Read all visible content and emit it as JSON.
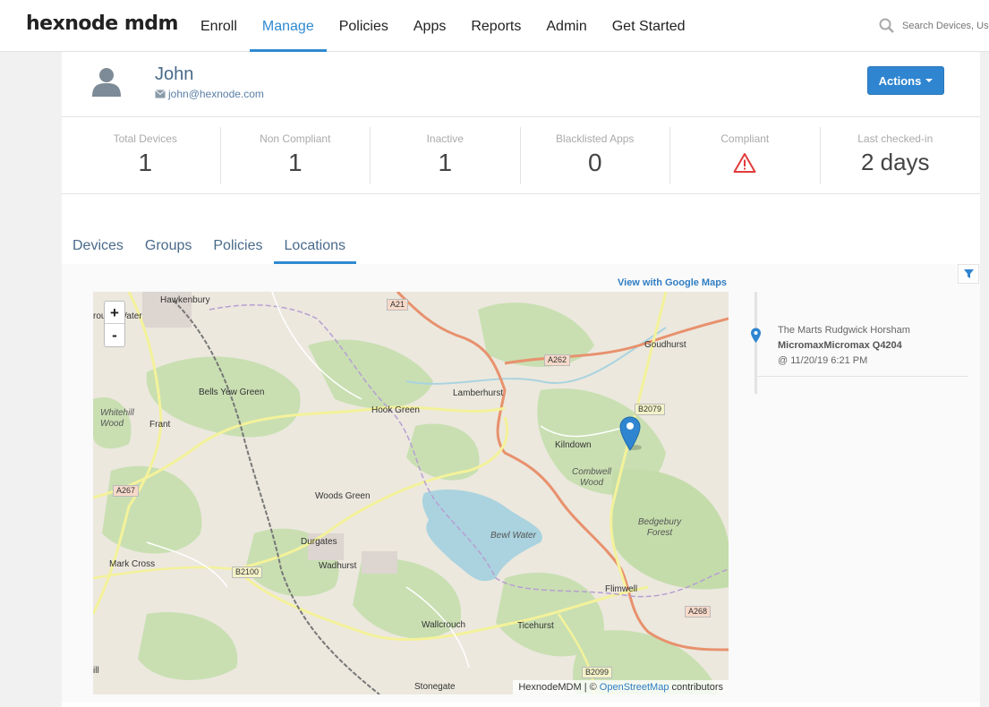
{
  "app": {
    "logo": "hexnode mdm",
    "nav": [
      "Enroll",
      "Manage",
      "Policies",
      "Apps",
      "Reports",
      "Admin",
      "Get Started"
    ],
    "active_nav": "Manage",
    "search_placeholder": "Search Devices, Us"
  },
  "user": {
    "name": "John",
    "email": "john@hexnode.com"
  },
  "actions_label": "Actions",
  "stats": [
    {
      "label": "Total Devices",
      "value": "1"
    },
    {
      "label": "Non Compliant",
      "value": "1"
    },
    {
      "label": "Inactive",
      "value": "1"
    },
    {
      "label": "Blacklisted Apps",
      "value": "0"
    },
    {
      "label": "Compliant",
      "icon": "warning-triangle-icon"
    },
    {
      "label": "Last checked-in",
      "value": "2 days"
    }
  ],
  "tabs": [
    "Devices",
    "Groups",
    "Policies",
    "Locations"
  ],
  "active_tab": "Locations",
  "map": {
    "google_link": "View with Google Maps",
    "zoom_in": "+",
    "zoom_out": "-",
    "attribution": {
      "prefix": "HexnodeMDM | ©",
      "link": "OpenStreetMap",
      "suffix": "contributors"
    },
    "places": [
      "Hawkenbury",
      "rough Water",
      "Bells Yew Green",
      "Whitehill Wood",
      "Frant",
      "Hook Green",
      "Lamberhurst",
      "Goudhurst",
      "Kilndown",
      "Combwell Wood",
      "Woods Green",
      "Durgates",
      "Wadhurst",
      "Mark Cross",
      "Bewl Water",
      "Bedgebury Forest",
      "Flimwell",
      "Wallcrouch",
      "Ticehurst",
      "Stonegate",
      "ill",
      "ill"
    ],
    "roads": [
      "A21",
      "A262",
      "B2079",
      "A267",
      "B2100",
      "A268",
      "B2099"
    ]
  },
  "location": {
    "place": "The Marts Rudgwick Horsham",
    "device": "MicromaxMicromax Q4204",
    "time": "@ 11/20/19 6:21 PM"
  },
  "colors": {
    "accent": "#2f8ad1",
    "button": "#2f85d0",
    "warning": "#e23b3b"
  }
}
